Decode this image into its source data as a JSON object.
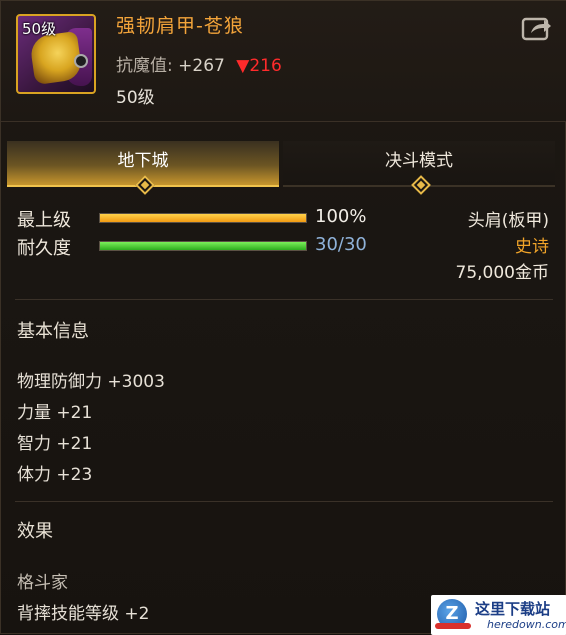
{
  "item": {
    "icon_level": "50级",
    "name": "强韧肩甲-苍狼",
    "resist_label": "抗魔值:",
    "resist_value": "+267",
    "resist_diff": "▼216",
    "level": "50级"
  },
  "tabs": [
    {
      "label": "地下城",
      "active": true
    },
    {
      "label": "决斗模式",
      "active": false
    }
  ],
  "stats": {
    "upgrade": {
      "label": "最上级",
      "value": "100%",
      "fraction": 1.0
    },
    "durability": {
      "label": "耐久度",
      "value": "30/30",
      "fraction": 1.0
    }
  },
  "info": {
    "slot": "头肩(板甲)",
    "rarity": "史诗",
    "price": "75,000金币"
  },
  "basic": {
    "title": "基本信息",
    "lines": [
      "物理防御力 +3003",
      "力量 +21",
      "智力 +21",
      "体力 +23"
    ]
  },
  "effect": {
    "title": "效果",
    "class": "格斗家",
    "skill": "背摔技能等级 +2"
  },
  "watermark": {
    "name": "这里下载站",
    "url": "heredown.com"
  },
  "colors": {
    "accent": "#f3a43a",
    "epic": "#f1a429",
    "down": "#ff2b2b",
    "frame": "#d9a322"
  },
  "icons": {
    "share": "share-icon"
  }
}
